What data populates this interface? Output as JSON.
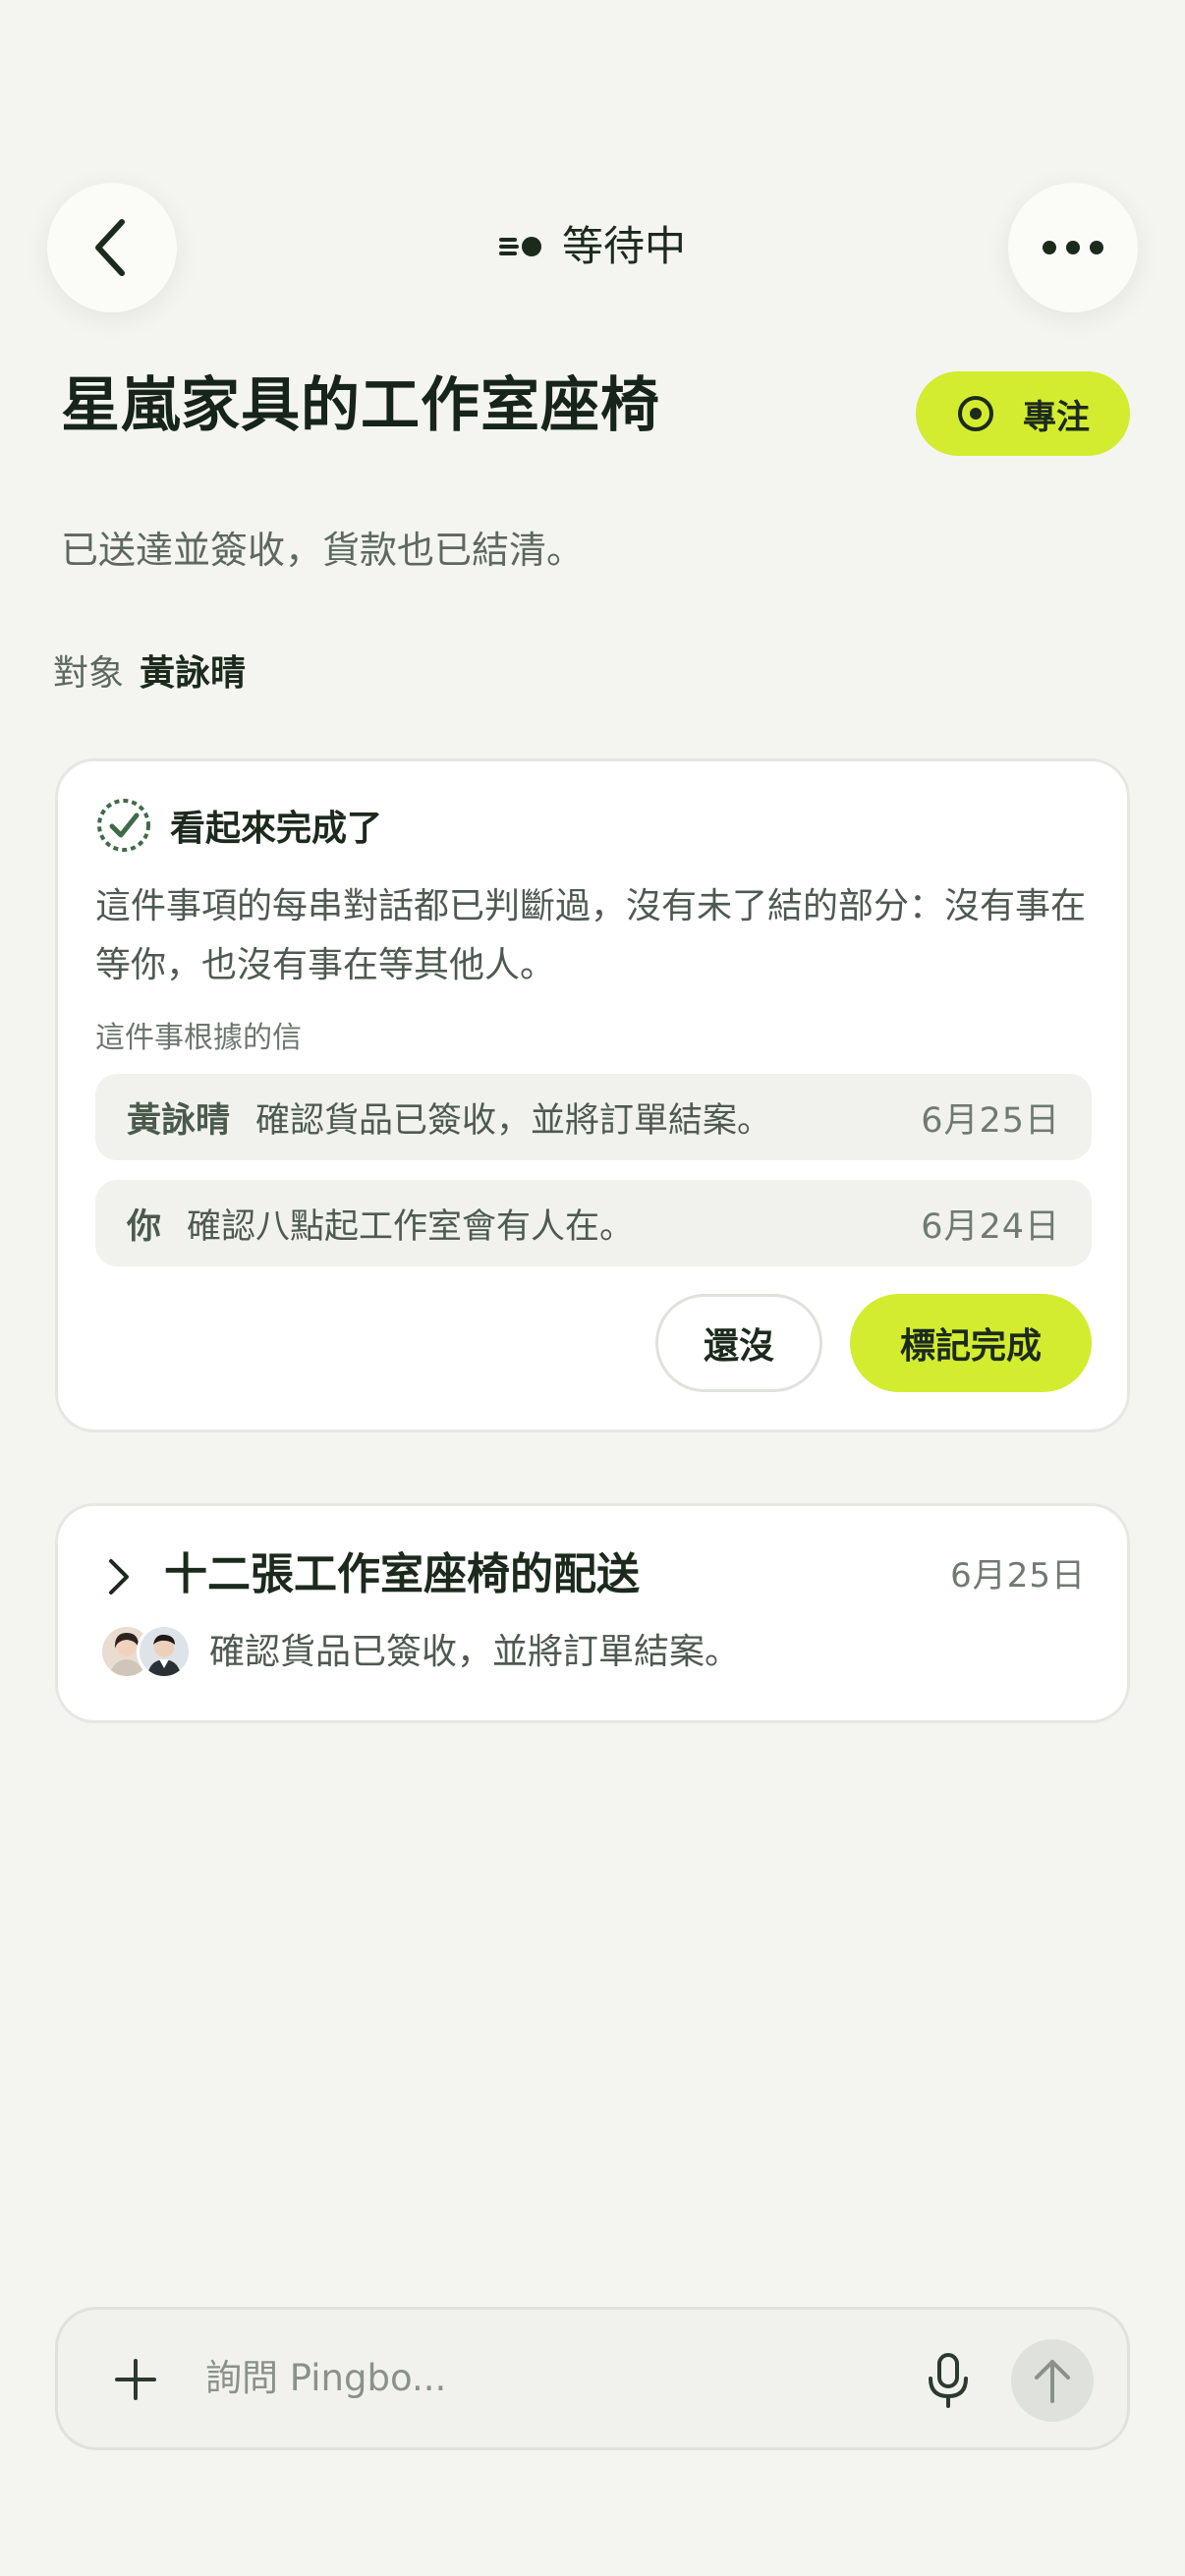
{
  "header": {
    "status_label": "等待中"
  },
  "title": "星嵐家具的工作室座椅",
  "focus_chip": {
    "label": "專注"
  },
  "description": "已送達並簽收，貨款也已結清。",
  "target": {
    "label": "對象",
    "name": "黃詠晴"
  },
  "completion_card": {
    "heading": "看起來完成了",
    "body": "這件事項的每串對話都已判斷過，沒有未了結的部分：沒有事在等你，也沒有事在等其他人。",
    "evidence_label": "這件事根據的信",
    "evidence": [
      {
        "sender": "黃詠晴",
        "message": "確認貨品已簽收，並將訂單結案。",
        "date": "6月25日"
      },
      {
        "sender": "你",
        "message": "確認八點起工作室會有人在。",
        "date": "6月24日"
      }
    ],
    "not_yet_label": "還沒",
    "mark_done_label": "標記完成"
  },
  "thread_card": {
    "title": "十二張工作室座椅的配送",
    "date": "6月25日",
    "preview": "確認貨品已簽收，並將訂單結案。"
  },
  "composer": {
    "placeholder": "詢問 Pingbo..."
  },
  "colors": {
    "background": "#f4f5f1",
    "accent": "#d3ec2f",
    "text_primary": "#1c2a1d",
    "text_secondary": "#5d6860"
  },
  "icons": {
    "back": "chevron-left-icon",
    "more": "more-horizontal-icon",
    "status": "waiting-icon",
    "focus": "target-icon",
    "check": "check-circle-icon",
    "expand": "chevron-right-icon",
    "add": "plus-icon",
    "mic": "microphone-icon",
    "send": "arrow-up-icon"
  }
}
